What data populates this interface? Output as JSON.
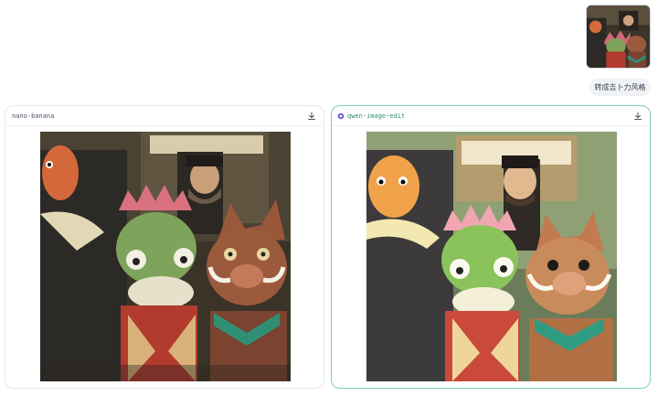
{
  "user_message": {
    "image_icon": "user-uploaded-image",
    "prompt": "转成吉卜力风格"
  },
  "results": [
    {
      "model": "nano-banana",
      "download_icon": "download-icon",
      "image_icon": "generated-image"
    },
    {
      "model": "qwen-image-edit",
      "brand_icon": "qwen-logo-icon",
      "download_icon": "download-icon",
      "image_icon": "generated-image"
    }
  ],
  "colors": {
    "accent_border": "#7fcfae",
    "bubble_bg": "#f1f2f4",
    "panel_border": "#e5e7eb"
  }
}
